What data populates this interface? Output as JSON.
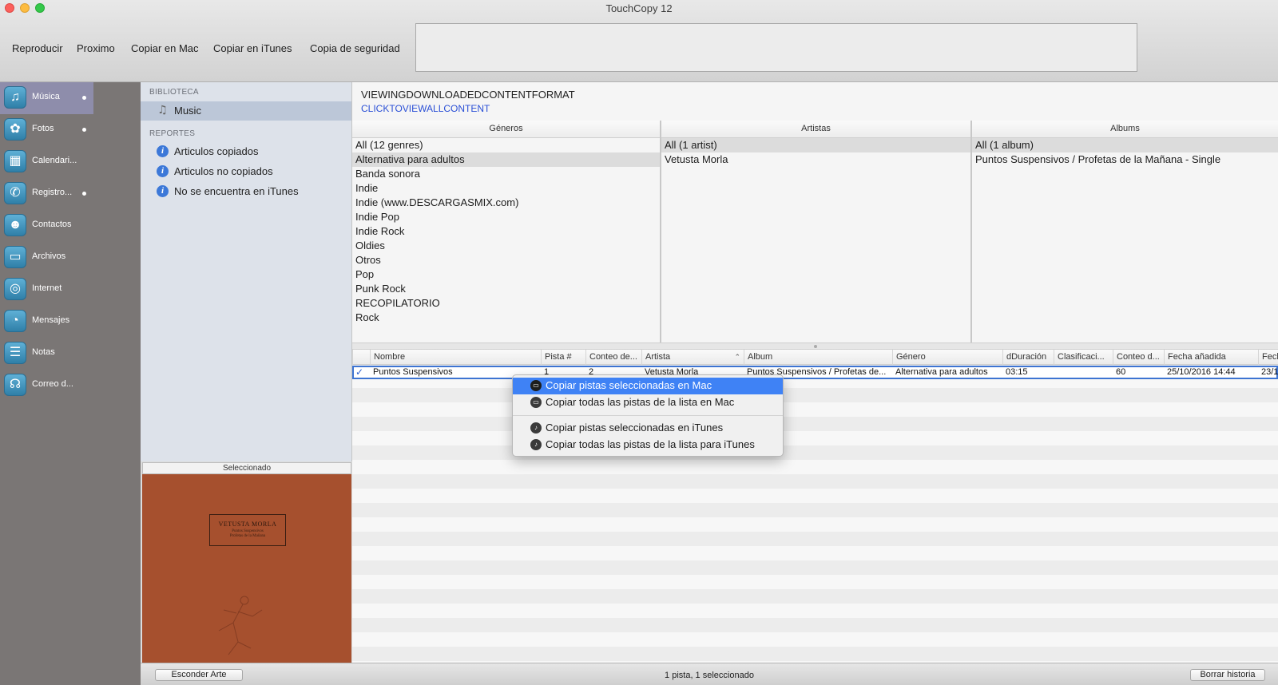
{
  "window": {
    "title": "TouchCopy 12"
  },
  "toolbar": {
    "play": "Reproducir",
    "next": "Proximo",
    "copy_mac": "Copiar en Mac",
    "copy_itunes": "Copiar en iTunes",
    "backup": "Copia de seguridad"
  },
  "categories": [
    {
      "label": "Música",
      "icon": "music-note-icon",
      "active": true,
      "dot": true
    },
    {
      "label": "Fotos",
      "icon": "flower-icon",
      "active": false,
      "dot": true
    },
    {
      "label": "Calendari...",
      "icon": "calendar-icon",
      "active": false,
      "dot": false
    },
    {
      "label": "Registro...",
      "icon": "phone-icon",
      "active": false,
      "dot": true
    },
    {
      "label": "Contactos",
      "icon": "contacts-icon",
      "active": false,
      "dot": false
    },
    {
      "label": "Archivos",
      "icon": "folder-icon",
      "active": false,
      "dot": false
    },
    {
      "label": "Internet",
      "icon": "globe-icon",
      "active": false,
      "dot": false
    },
    {
      "label": "Mensajes",
      "icon": "speech-bubble-icon",
      "active": false,
      "dot": false
    },
    {
      "label": "Notas",
      "icon": "notepad-icon",
      "active": false,
      "dot": false
    },
    {
      "label": "Correo d...",
      "icon": "voicemail-icon",
      "active": false,
      "dot": false
    }
  ],
  "sidebar": {
    "library_heading": "BIBLIOTECA",
    "library_item": "Music",
    "reports_heading": "REPORTES",
    "reports": [
      "Articulos copiados",
      "Articulos no copiados",
      "No se encuentra en iTunes"
    ]
  },
  "artwork": {
    "header": "Seleccionado",
    "band": "VETUSTA MORLA",
    "subtitle_line1": "Puntos Suspensivos",
    "subtitle_line2": "Profetas de la Mañana"
  },
  "content": {
    "view_title": "VIEWINGDOWNLOADEDCONTENTFORMAT",
    "view_link": "CLICKTOVIEWALLCONTENT"
  },
  "browsers": {
    "genres": {
      "header": "Géneros",
      "items": [
        "All (12 genres)",
        "Alternativa para adultos",
        "Banda sonora",
        "Indie",
        "Indie (www.DESCARGASMIX.com)",
        "Indie Pop",
        "Indie Rock",
        "Oldies",
        "Otros",
        "Pop",
        "Punk Rock",
        "RECOPILATORIO",
        "Rock"
      ],
      "selected": 1
    },
    "artists": {
      "header": "Artistas",
      "items": [
        "All (1 artist)",
        "Vetusta Morla"
      ],
      "selected": 0
    },
    "albums": {
      "header": "Albums",
      "items": [
        "All (1 album)",
        "Puntos Suspensivos / Profetas de la Mañana - Single"
      ],
      "selected": 0
    }
  },
  "tracks": {
    "columns": [
      "Nombre",
      "Pista #",
      "Conteo de...",
      "Artista",
      "Album",
      "Género",
      "dDuración",
      "Clasificaci...",
      "Conteo d...",
      "Fecha añadida",
      "Fecl"
    ],
    "rows": [
      {
        "checked": true,
        "name": "Puntos Suspensivos",
        "track": "1",
        "count": "2",
        "artist": "Vetusta Morla",
        "album": "Puntos Suspensivos / Profetas de...",
        "genre": "Alternativa para adultos",
        "duration": "03:15",
        "rating": "",
        "play_count": "60",
        "date_added": "25/10/2016 14:44",
        "date_other": "23/1"
      }
    ]
  },
  "context_menu": {
    "items": [
      {
        "label": "Copiar pistas seleccionadas en Mac",
        "highlighted": true
      },
      {
        "label": "Copiar todas las pistas de la lista en Mac",
        "highlighted": false
      },
      {
        "label": "Copiar pistas seleccionadas en iTunes",
        "highlighted": false
      },
      {
        "label": "Copiar todas las pistas de la lista para iTunes",
        "highlighted": false
      }
    ]
  },
  "statusbar": {
    "hide_art": "Esconder Arte",
    "status": "1 pista, 1 seleccionado",
    "clear_history": "Borrar historia"
  },
  "colors": {
    "accent": "#3f82f5",
    "rail": "#7a7675",
    "rail_active": "#8e8dab",
    "link": "#2a4fd6",
    "art": "#a6502e"
  }
}
